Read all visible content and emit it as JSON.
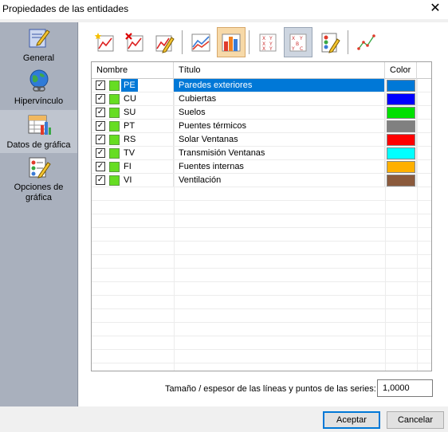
{
  "window": {
    "title": "Propiedades de las entidades",
    "close_glyph": "✕"
  },
  "sidebar": {
    "items": [
      {
        "label": "General",
        "icon": "pencil-notepad-icon"
      },
      {
        "label": "Hipervínculo",
        "icon": "globe-link-icon"
      },
      {
        "label": "Datos de gráfica",
        "icon": "chart-table-icon",
        "active": true
      },
      {
        "label": "Opciones de gráfica",
        "icon": "chart-options-icon"
      }
    ]
  },
  "toolbar": {
    "buttons": [
      {
        "name": "new-series-icon"
      },
      {
        "name": "delete-series-icon"
      },
      {
        "name": "edit-series-icon"
      },
      {
        "name": "line-chart-icon"
      },
      {
        "name": "bar-chart-icon",
        "state": "active"
      },
      {
        "name": "xy-table-icon"
      },
      {
        "name": "xyz-table-icon",
        "state": "pressed"
      },
      {
        "name": "legend-edit-icon"
      },
      {
        "name": "scatter-line-icon"
      }
    ]
  },
  "grid": {
    "headers": {
      "name": "Nombre",
      "title": "Título",
      "color": "Color"
    },
    "rows": [
      {
        "code": "PE",
        "title": "Paredes exteriores",
        "color": "#0078d7",
        "checked": true,
        "selected": true
      },
      {
        "code": "CU",
        "title": "Cubiertas",
        "color": "#0000ff",
        "checked": true
      },
      {
        "code": "SU",
        "title": "Suelos",
        "color": "#00e000",
        "checked": true
      },
      {
        "code": "PT",
        "title": "Puentes térmicos",
        "color": "#808080",
        "checked": true
      },
      {
        "code": "RS",
        "title": "Solar Ventanas",
        "color": "#ff0000",
        "checked": true
      },
      {
        "code": "TV",
        "title": "Transmisión Ventanas",
        "color": "#00ffff",
        "checked": true
      },
      {
        "code": "FI",
        "title": "Fuentes internas",
        "color": "#ffb000",
        "checked": true
      },
      {
        "code": "VI",
        "title": "Ventilación",
        "color": "#8b5a3c",
        "checked": true
      }
    ],
    "series_marker_color": "#66dd22"
  },
  "line_size": {
    "label": "Tamaño / espesor de las líneas y puntos de las series:",
    "value": "1,0000"
  },
  "footer": {
    "ok_label": "Aceptar",
    "cancel_label": "Cancelar"
  }
}
